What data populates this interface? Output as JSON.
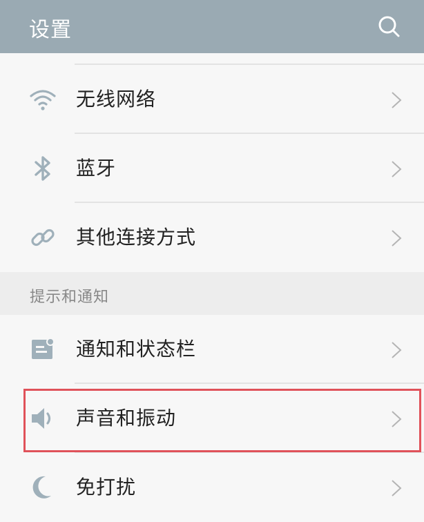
{
  "header": {
    "title": "设置",
    "search_icon": "search-icon"
  },
  "rows": [
    {
      "label": "无线网络",
      "icon": "wifi-icon"
    },
    {
      "label": "蓝牙",
      "icon": "bluetooth-icon"
    },
    {
      "label": "其他连接方式",
      "icon": "link-icon"
    },
    {
      "label": "通知和状态栏",
      "icon": "notification-icon"
    },
    {
      "label": "声音和振动",
      "icon": "speaker-icon"
    },
    {
      "label": "免打扰",
      "icon": "moon-icon"
    }
  ],
  "section": {
    "title": "提示和通知"
  },
  "colors": {
    "header_bg": "#9aaab3",
    "icon_color": "#9fb0ba",
    "highlight_border": "#e0525a"
  }
}
